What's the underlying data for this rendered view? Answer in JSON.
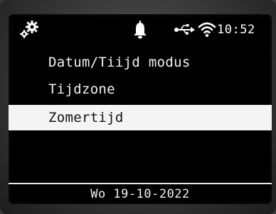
{
  "status_bar": {
    "icons": [
      "gear-icon",
      "bell-icon",
      "usb-icon",
      "wifi-icon"
    ],
    "time": "10:52"
  },
  "menu": {
    "items": [
      {
        "label": "Datum/Tiijd modus",
        "selected": false
      },
      {
        "label": "Tijdzone",
        "selected": false
      },
      {
        "label": "Zomertijd",
        "selected": true
      }
    ]
  },
  "footer": {
    "date": "Wo 19-10-2022"
  },
  "colors": {
    "screen_background": "#000000",
    "text": "#f2f2f2",
    "highlight": "#f4f4f4"
  }
}
